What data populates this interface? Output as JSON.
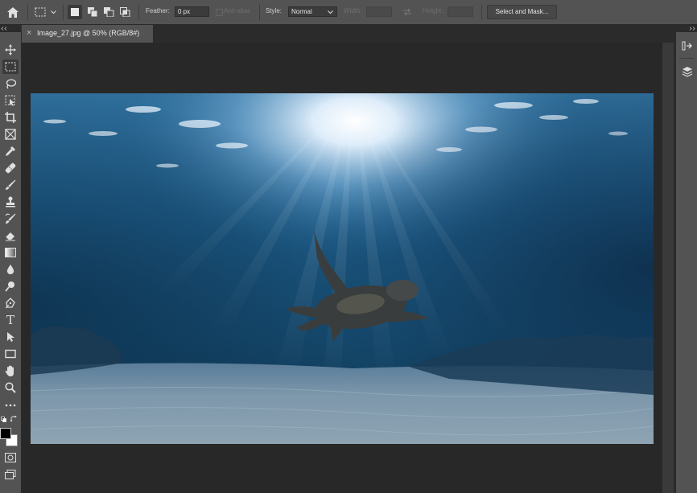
{
  "options_bar": {
    "feather_label": "Feather:",
    "feather_value": "0 px",
    "anti_alias_label": "Anti-alias",
    "style_label": "Style:",
    "style_value": "Normal",
    "width_label": "Width:",
    "height_label": "Height:",
    "select_mask_label": "Select and Mask..."
  },
  "document": {
    "tab_title": "Image_27.jpg @ 50% (RGB/8#)",
    "close_glyph": "×"
  },
  "colors": {
    "foreground": "#000000",
    "background": "#ffffff",
    "ui_panel": "#535353",
    "ui_dark": "#2b2b2b"
  },
  "tools": [
    "move-icon",
    "marquee-icon",
    "lasso-icon",
    "object-select-icon",
    "crop-icon",
    "frame-icon",
    "eyedropper-icon",
    "healing-brush-icon",
    "brush-icon",
    "clone-stamp-icon",
    "history-brush-icon",
    "eraser-icon",
    "gradient-icon",
    "blur-icon",
    "dodge-icon",
    "pen-icon",
    "type-icon",
    "path-select-icon",
    "rectangle-icon",
    "hand-icon",
    "zoom-icon",
    "more-tools-icon"
  ],
  "text_tool_glyph": "T"
}
